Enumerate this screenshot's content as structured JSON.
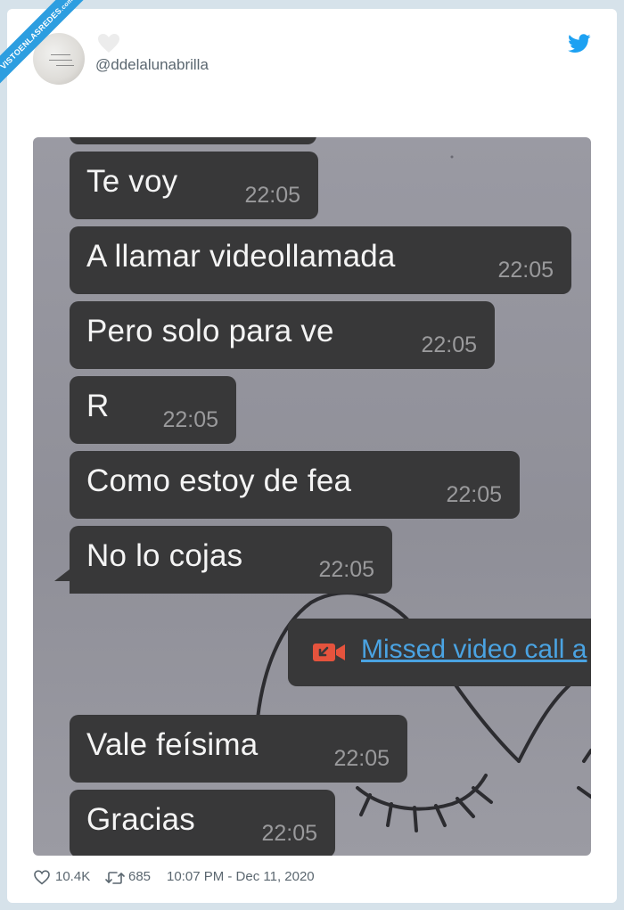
{
  "watermark": {
    "text": "VISTOENLASREDES",
    "suffix": ".com"
  },
  "tweet": {
    "handle": "@ddelalunabrilla",
    "likes": "10.4K",
    "retweets": "685",
    "timestamp": "10:07 PM - Dec 11, 2020"
  },
  "chat": {
    "messages": [
      {
        "text": "Te voy",
        "time": "22:05"
      },
      {
        "text": "A llamar videollamada",
        "time": "22:05"
      },
      {
        "text": "Pero solo para ve",
        "time": "22:05"
      },
      {
        "text": "R",
        "time": "22:05"
      },
      {
        "text": "Como estoy de fea",
        "time": "22:05"
      },
      {
        "text": "No lo cojas",
        "time": "22:05"
      },
      {
        "text": "Vale feísima",
        "time": "22:05"
      },
      {
        "text": "Gracias",
        "time": "22:05"
      }
    ],
    "missed_call": {
      "text": "Missed video call a",
      "icon": "missed-video-call-icon",
      "color": "#e5533d"
    }
  },
  "colors": {
    "twitter_blue": "#1da1f2",
    "bubble": "#383839",
    "link": "#4aa3e2"
  }
}
